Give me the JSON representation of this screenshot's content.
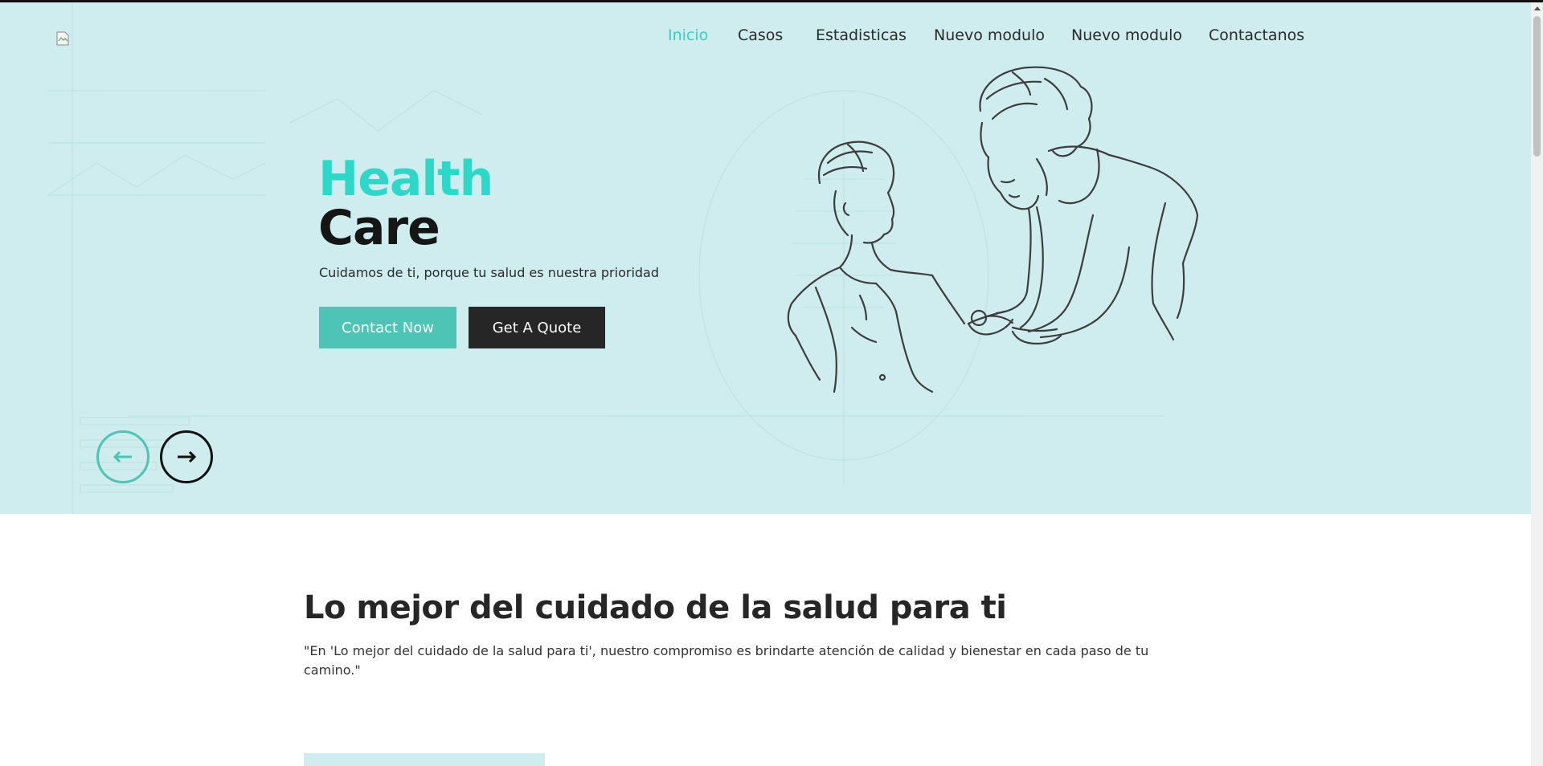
{
  "logo": {
    "alt": ""
  },
  "nav": {
    "items": [
      {
        "label": "Inicio",
        "active": true
      },
      {
        "label": "Casos"
      },
      {
        "label": "Estadisticas"
      },
      {
        "label": "Nuevo modulo"
      },
      {
        "label": "Nuevo modulo"
      },
      {
        "label": "Contactanos"
      }
    ]
  },
  "hero": {
    "title_line1": "Health",
    "title_line2": "Care",
    "tagline": "Cuidamos de ti, porque tu salud es nuestra prioridad",
    "primary_button": "Contact Now",
    "secondary_button": "Get A Quote",
    "prev_icon": "arrow-left-icon",
    "next_icon": "arrow-right-icon",
    "illustration": "doctor-examining-patient-sketch",
    "background_color": "#cfecee",
    "accent_color": "#2ed8c9",
    "button_color": "#4ec4b6"
  },
  "section": {
    "title": "Lo mejor del cuidado de la salud para ti",
    "quote": "\"En 'Lo mejor del cuidado de la salud para ti', nuestro compromiso es brindarte atención de calidad y bienestar en cada paso de tu camino.\""
  }
}
